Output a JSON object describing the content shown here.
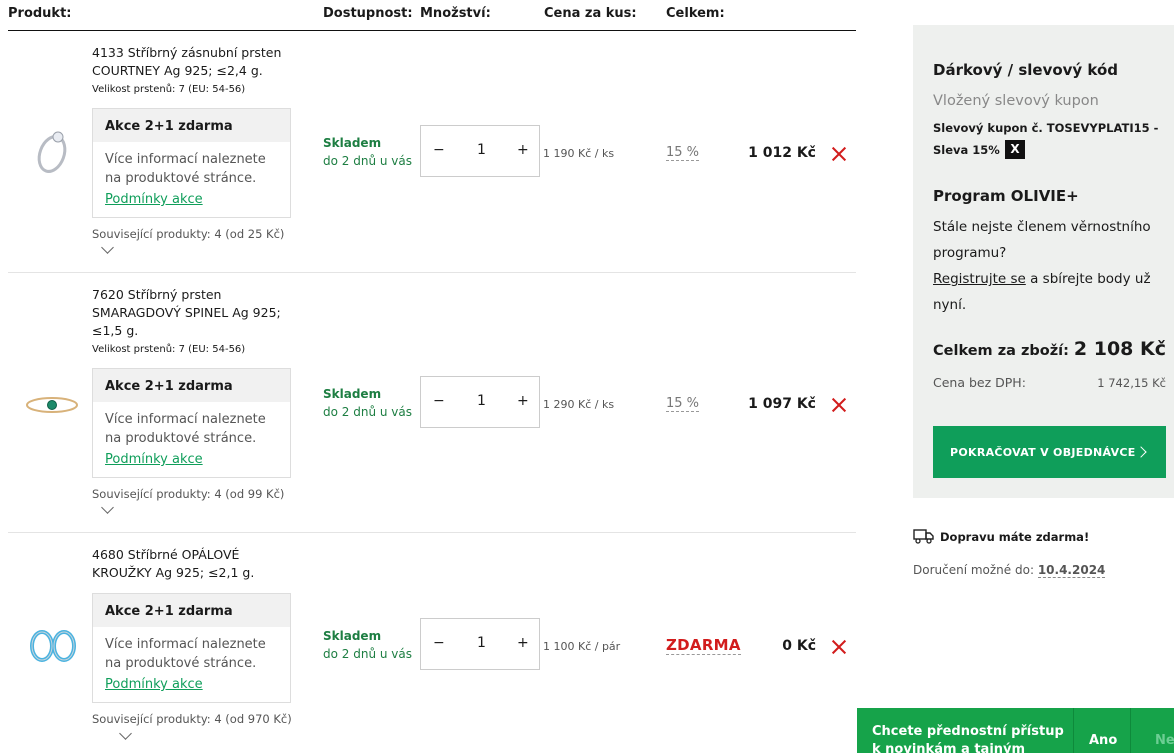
{
  "headers": {
    "product": "Produkt:",
    "availability": "Dostupnost:",
    "quantity": "Množství:",
    "unit_price": "Cena za kus:",
    "total": "Celkem:"
  },
  "items": [
    {
      "name": "4133 Stříbrný zásnubní prsten COURTNEY Ag 925; ≤2,4 g.",
      "size": "Velikost prstenů: 7 (EU: 54-56)",
      "promo_title": "Akce 2+1 zdarma",
      "promo_text": "Více informací naleznete na produktové stránce.",
      "promo_link": "Podmínky akce",
      "related": "Související produkty: 4 (od 25 Kč)",
      "avail1": "Skladem",
      "avail2": "do 2 dnů u vás",
      "minus": "−",
      "qty": "1",
      "plus": "+",
      "unit_price": "1 190 Kč / ks",
      "discount": "15 %",
      "total": "1 012 Kč",
      "image_icon": "silver-ring-icon"
    },
    {
      "name": "7620 Stříbrný prsten SMARAGDOVÝ SPINEL Ag 925; ≤1,5 g.",
      "size": "Velikost prstenů: 7 (EU: 54-56)",
      "promo_title": "Akce 2+1 zdarma",
      "promo_text": "Více informací naleznete na produktové stránce.",
      "promo_link": "Podmínky akce",
      "related": "Související produkty: 4 (od 99 Kč)",
      "avail1": "Skladem",
      "avail2": "do 2 dnů u vás",
      "minus": "−",
      "qty": "1",
      "plus": "+",
      "unit_price": "1 290 Kč / ks",
      "discount": "15 %",
      "total": "1 097 Kč",
      "image_icon": "emerald-ring-icon"
    },
    {
      "name": "4680 Stříbrné OPÁLOVÉ KROUŽKY Ag 925; ≤2,1 g.",
      "promo_title": "Akce 2+1 zdarma",
      "promo_text": "Více informací naleznete na produktové stránce.",
      "promo_link": "Podmínky akce",
      "related": "Související produkty: 4 (od 970 Kč)",
      "avail1": "Skladem",
      "avail2": "do 2 dnů u vás",
      "minus": "−",
      "qty": "1",
      "plus": "+",
      "unit_price": "1 100 Kč / pár",
      "discount": "ZDARMA",
      "total": "0 Kč",
      "image_icon": "opal-earrings-icon"
    }
  ],
  "sidebar": {
    "coupon_title": "Dárkový / slevový kód",
    "coupon_applied": "Vložený slevový kupon",
    "coupon_line1": "Slevový kupon č. TOSEVYPLATI15 -",
    "coupon_line2": "Sleva 15%",
    "coupon_remove": "X",
    "program_title": "Program OLIVIE+",
    "program_text1": "Stále nejste členem věrnostního",
    "program_text2": "programu?",
    "program_link": "Registrujte se",
    "program_text3": " a sbírejte body už",
    "program_text4": "nyní.",
    "total_label": "Celkem za zboží:",
    "total_value": "2 108 Kč",
    "vat_label": "Cena bez DPH:",
    "vat_value": "1 742,15 Kč",
    "continue_button": "POKRAČOVAT V OBJEDNÁVCE"
  },
  "shipping": {
    "free_text": "Dopravu máte zdarma!",
    "delivery_label": "Doručení možné do:",
    "delivery_date": "10.4.2024"
  },
  "notification": {
    "line1": "Chcete přednostní přístup",
    "line2": "k novinkám a tajným slevám?",
    "yes": "Ano",
    "no": "Ne"
  },
  "colors": {
    "accent": "#0f9e5a",
    "remove": "#d21c1c",
    "sidebar_bg": "#eef0ee"
  }
}
